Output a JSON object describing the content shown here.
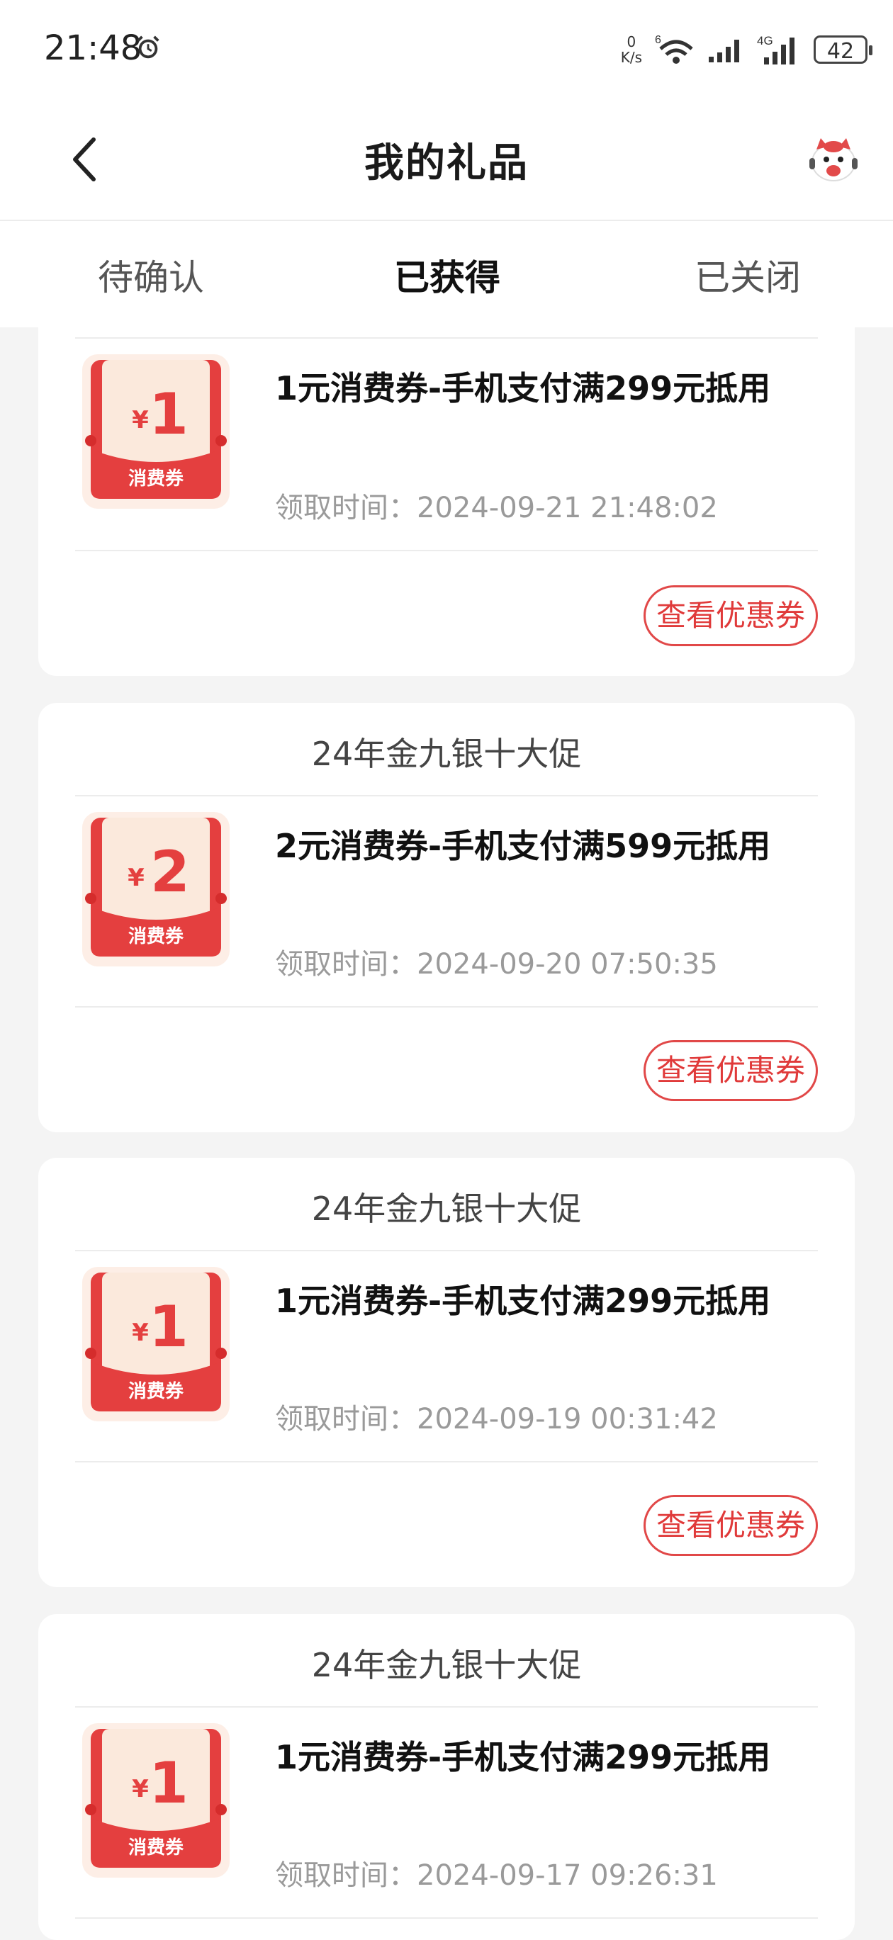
{
  "status_bar": {
    "time": "21:48",
    "net_speed_value": "0",
    "net_speed_unit": "K/s",
    "wifi_badge": "6",
    "network_type": "4G",
    "battery": "42"
  },
  "header": {
    "title": "我的礼品"
  },
  "tabs": [
    {
      "label": "待确认"
    },
    {
      "label": "已获得"
    },
    {
      "label": "已关闭"
    }
  ],
  "coupon_badge_label": "消费券",
  "yen_symbol": "¥",
  "cards": [
    {
      "title": "",
      "amount": "1",
      "name": "1元消费券-手机支付满299元抵用",
      "time": "领取时间：2024-09-21 21:48:02",
      "button": "查看优惠券"
    },
    {
      "title": "24年金九银十大促",
      "amount": "2",
      "name": "2元消费券-手机支付满599元抵用",
      "time": "领取时间：2024-09-20 07:50:35",
      "button": "查看优惠券"
    },
    {
      "title": "24年金九银十大促",
      "amount": "1",
      "name": "1元消费券-手机支付满299元抵用",
      "time": "领取时间：2024-09-19 00:31:42",
      "button": "查看优惠券"
    },
    {
      "title": "24年金九银十大促",
      "amount": "1",
      "name": "1元消费券-手机支付满299元抵用",
      "time": "领取时间：2024-09-17 09:26:31",
      "button": ""
    }
  ],
  "colors": {
    "accent_red": "#e03a3a",
    "background": "#f4f4f4"
  }
}
